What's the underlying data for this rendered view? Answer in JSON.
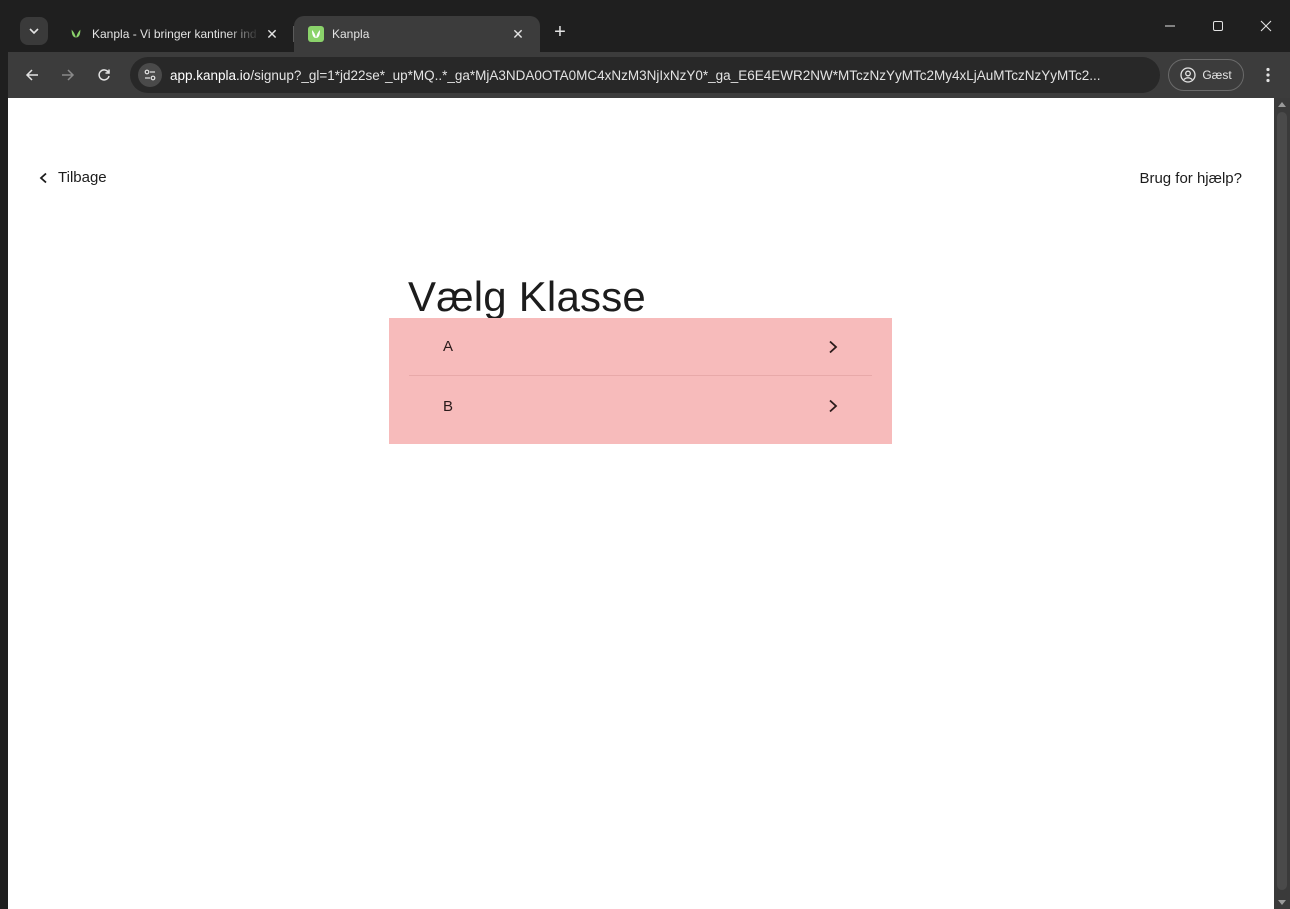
{
  "browser": {
    "tabs": [
      {
        "title": "Kanpla - Vi bringer kantiner ind",
        "active": false
      },
      {
        "title": "Kanpla",
        "active": true
      }
    ],
    "new_tab_label": "+",
    "close_label": "✕",
    "url": {
      "domain": "app.kanpla.io",
      "path": "/signup?_gl=1*jd22se*_up*MQ..*_ga*MjA3NDA0OTA0MC4xNzM3NjIxNzY0*_ga_E6E4EWR2NW*MTczNzYyMTc2My4xLjAuMTczNzYyMTc2..."
    },
    "profile_label": "Gæst",
    "accent_color": "#8bd36b"
  },
  "page": {
    "back_label": "Tilbage",
    "help_label": "Brug for hjælp?",
    "title": "Vælg Klasse",
    "list_background": "#f7bbbb",
    "classes": [
      {
        "label": "A"
      },
      {
        "label": "B"
      }
    ]
  }
}
